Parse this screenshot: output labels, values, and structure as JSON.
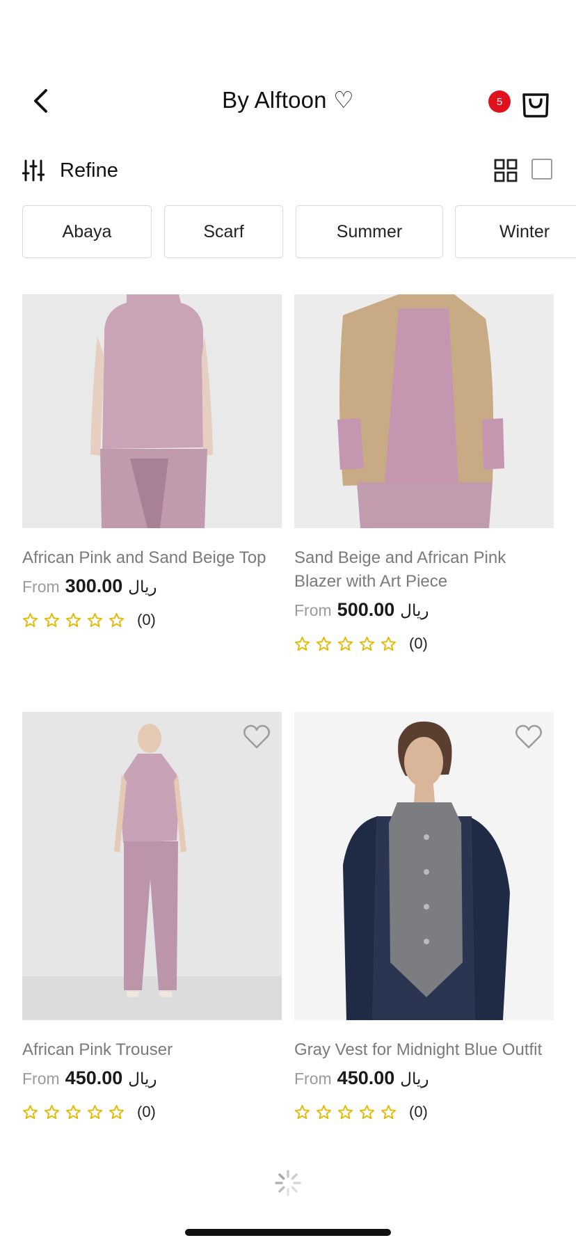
{
  "header": {
    "title": "By Alftoon ♡",
    "cart_count": "5"
  },
  "toolbar": {
    "refine_label": "Refine"
  },
  "chips": [
    "Abaya",
    "Scarf",
    "Summer",
    "Winter"
  ],
  "products": [
    {
      "name": "African Pink and Sand Beige Top",
      "from_label": "From",
      "price": "300.00",
      "currency": "ريال",
      "rating_count": "(0)",
      "rating": 0
    },
    {
      "name": "Sand Beige and African Pink Blazer with Art Piece",
      "from_label": "From",
      "price": "500.00",
      "currency": "ريال",
      "rating_count": "(0)",
      "rating": 0
    },
    {
      "name": "African Pink Trouser",
      "from_label": "From",
      "price": "450.00",
      "currency": "ريال",
      "rating_count": "(0)",
      "rating": 0
    },
    {
      "name": "Gray Vest for Midnight Blue Outfit",
      "from_label": "From",
      "price": "450.00",
      "currency": "ريال",
      "rating_count": "(0)",
      "rating": 0
    }
  ],
  "colors": {
    "badge": "#e0121e",
    "star": "#e6b800",
    "accent_pink": "#b990a8"
  }
}
